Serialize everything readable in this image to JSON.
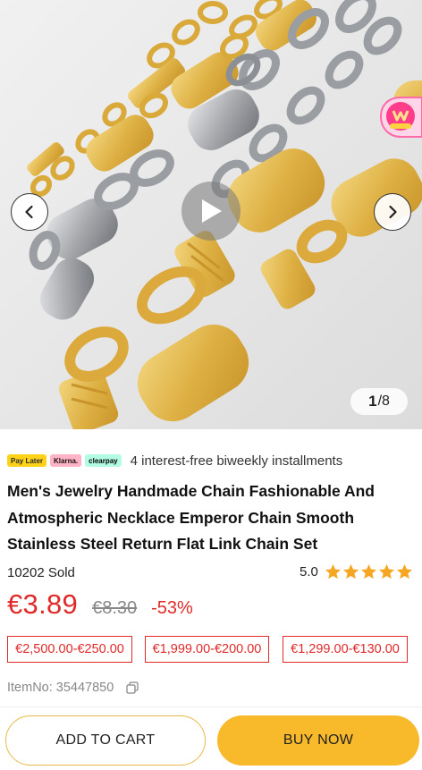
{
  "gallery": {
    "current_image": "1",
    "separator_total": "/8",
    "icons": {
      "prev": "chevron-left-icon",
      "next": "chevron-right-icon",
      "play": "play-icon",
      "badge": "vip-badge-icon"
    }
  },
  "payment": {
    "badges": [
      "Pay Later",
      "Klarna.",
      "clearpay"
    ],
    "installments_text": "4 interest-free biweekly installments"
  },
  "product": {
    "title": "Men's Jewelry Handmade Chain Fashionable And Atmospheric Necklace Emperor Chain Smooth Stainless Steel Return Flat Link Chain Set",
    "sold": "10202 Sold",
    "rating": "5.0",
    "stars": 5,
    "price": "€3.89",
    "original_price": "€8.30",
    "discount": "-53%",
    "tiers": [
      "€2,500.00-€250.00",
      "€1,999.00-€200.00",
      "€1,299.00-€130.00"
    ],
    "item_no": "ItemNo: 35447850"
  },
  "actions": {
    "add_to_cart": "ADD TO CART",
    "buy_now": "BUY NOW"
  },
  "colors": {
    "accent_red": "#e02a2a",
    "buy_button": "#f8b92b",
    "star": "#f5a623",
    "gold": "#e2b84a",
    "silver": "#a9abae"
  }
}
